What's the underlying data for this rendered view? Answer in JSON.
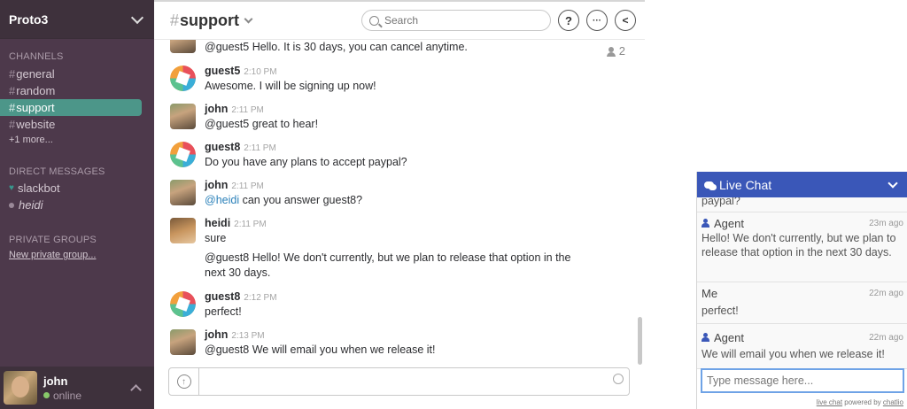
{
  "sidebar": {
    "team_name": "Proto3",
    "channels_title": "CHANNELS",
    "channels": [
      {
        "name": "general"
      },
      {
        "name": "random"
      },
      {
        "name": "support"
      },
      {
        "name": "website"
      }
    ],
    "hash": "#",
    "more_label": "+1 more...",
    "dm_title": "DIRECT MESSAGES",
    "dms": [
      {
        "name": "slackbot"
      },
      {
        "name": "heidi"
      }
    ],
    "pg_title": "PRIVATE GROUPS",
    "new_pg_label": "New private group...",
    "user": {
      "name": "john",
      "status": "online"
    }
  },
  "header": {
    "channel": "support",
    "search_placeholder": "Search",
    "help_label": "?",
    "more_label": "···",
    "back_label": "<",
    "member_count": "2"
  },
  "messages": [
    {
      "user": "",
      "time": "",
      "text": "@guest5 Hello.  It is 30 days, you can cancel anytime."
    },
    {
      "user": "guest5",
      "time": "2:10 PM",
      "text": "Awesome.  I will be signing up now!"
    },
    {
      "user": "john",
      "time": "2:11 PM",
      "text": "@guest5 great to hear!"
    },
    {
      "user": "guest8",
      "time": "2:11 PM",
      "text": "Do you have any plans to accept paypal?"
    },
    {
      "user": "john",
      "time": "2:11 PM",
      "mention": "@heidi",
      "text": " can you answer guest8?"
    },
    {
      "user": "heidi",
      "time": "2:11 PM",
      "text": "sure"
    },
    {
      "user": "",
      "time": "",
      "text": "@guest8 Hello! We don't currently, but we plan to release that option in the next 30 days."
    },
    {
      "user": "guest8",
      "time": "2:12 PM",
      "text": "perfect!"
    },
    {
      "user": "john",
      "time": "2:13 PM",
      "text": "@guest8 We will email you when we release it!"
    }
  ],
  "livechat": {
    "title": "Live Chat",
    "partial_text": "paypal?",
    "messages": [
      {
        "sender": "Agent",
        "time": "23m ago",
        "text": "Hello! We don't currently, but we plan to release that option in the next 30 days."
      },
      {
        "sender": "Me",
        "time": "22m ago",
        "text": "perfect!"
      },
      {
        "sender": "Agent",
        "time": "22m ago",
        "text": "We will email you when we release it!"
      }
    ],
    "input_placeholder": "Type message here...",
    "footer_link": "live chat",
    "footer_mid": " powered by ",
    "footer_brand": "chatlio"
  }
}
